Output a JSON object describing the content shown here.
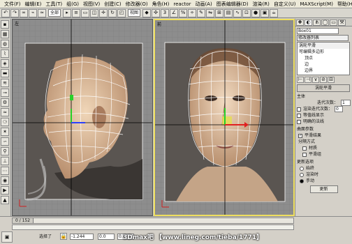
{
  "menubar": {
    "items": [
      "文件(F)",
      "编辑(E)",
      "工具(T)",
      "组(G)",
      "视图(V)",
      "创建(C)",
      "修改器(O)",
      "角色(H)",
      "reactor",
      "动画(A)",
      "图表编辑器(D)",
      "渲染(R)",
      "自定义(U)",
      "MAXScript(M)",
      "帮助(H)"
    ]
  },
  "toolbar": {
    "filter_value": "全部",
    "coord_value": "视图"
  },
  "viewports": {
    "left_label": "左",
    "front_label": "前"
  },
  "right_panel": {
    "object_name": "Box01",
    "modifier_list": "修改器列表",
    "stack": [
      "涡轮平滑",
      "可编辑多边形",
      "顶点",
      "边",
      "边界",
      "多边形",
      "元素"
    ],
    "rollout_title": "涡轮平滑",
    "main_label": "主体",
    "iterations_label": "迭代次数：",
    "iterations_value": "1",
    "render_iters_label": "渲染迭代次数：",
    "render_iters_value": "0",
    "isoline_label": "等值线显示",
    "explicit_normals_label": "明确的法线",
    "surface_label": "曲面参数",
    "smooth_result_label": "平滑结果",
    "separate_label": "分隔方式",
    "materials_label": "材质",
    "smoothing_groups_label": "平滑组",
    "update_options_label": "更新选项",
    "always_label": "始终",
    "when_rendering_label": "渲染时",
    "manually_label": "手动",
    "update_button": "更新"
  },
  "bottom": {
    "time_slider": "0 / 152",
    "selection_label": "选择了",
    "x_value": "-1.244",
    "y_value": "0.0",
    "z_value": "0.0",
    "watermark": "3Dmax吧 【www.lineg.com/tieba/1771】"
  }
}
